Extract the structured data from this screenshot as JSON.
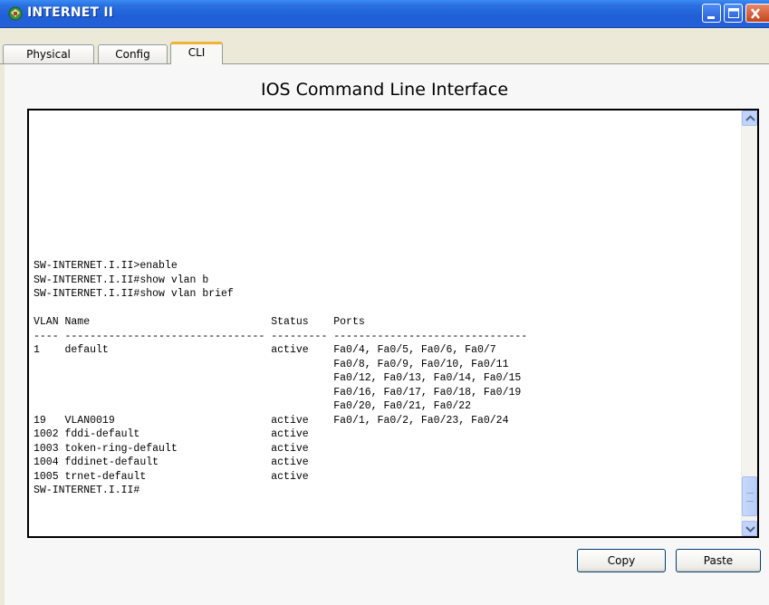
{
  "window": {
    "title": "INTERNET II",
    "icon": "network-device-icon"
  },
  "tabs": [
    {
      "label": "Physical",
      "selected": false
    },
    {
      "label": "Config",
      "selected": false
    },
    {
      "label": "CLI",
      "selected": true
    }
  ],
  "panel": {
    "heading": "IOS Command Line Interface"
  },
  "terminal": {
    "output": "SW-INTERNET.I.II>enable\nSW-INTERNET.I.II#show vlan b\nSW-INTERNET.I.II#show vlan brief\n\nVLAN Name                             Status    Ports\n---- -------------------------------- --------- -------------------------------\n1    default                          active    Fa0/4, Fa0/5, Fa0/6, Fa0/7\n                                                Fa0/8, Fa0/9, Fa0/10, Fa0/11\n                                                Fa0/12, Fa0/13, Fa0/14, Fa0/15\n                                                Fa0/16, Fa0/17, Fa0/18, Fa0/19\n                                                Fa0/20, Fa0/21, Fa0/22\n19   VLAN0019                         active    Fa0/1, Fa0/2, Fa0/23, Fa0/24\n1002 fddi-default                     active    \n1003 token-ring-default               active    \n1004 fddinet-default                  active    \n1005 trnet-default                    active    \nSW-INTERNET.I.II#"
  },
  "buttons": {
    "copy": "Copy",
    "paste": "Paste"
  },
  "colors": {
    "titlebar": "#2a6fe0",
    "selected_tab_accent": "#f0b33a",
    "scrollbar": "#c1d3fb"
  }
}
